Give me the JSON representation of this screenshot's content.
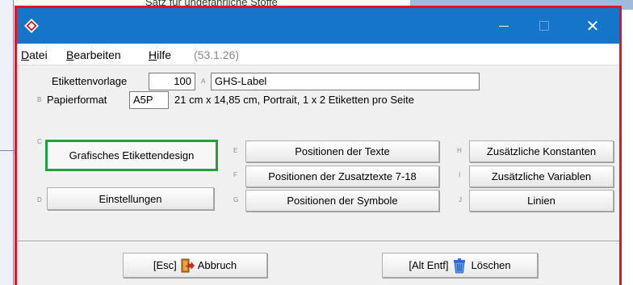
{
  "background": {
    "text": "Satz für ungefährliche Stoffe"
  },
  "window": {
    "accent_color": "#1475c9",
    "focus_color": "#e81123",
    "close_glyph": "✕"
  },
  "menu": {
    "items": [
      {
        "label_ul": "D",
        "label_rest": "atei"
      },
      {
        "label_ul": "B",
        "label_rest": "earbeiten"
      },
      {
        "label_ul": "H",
        "label_rest": "ilfe"
      }
    ],
    "version": "(53.1.26)"
  },
  "form": {
    "etikettenvorlage_label": "Etikettenvorlage",
    "etikettenvorlage_value": "100",
    "key_a": "A",
    "name_value": "GHS-Label",
    "key_b": "B",
    "papierformat_label": "Papierformat",
    "papierformat_value": "A5P",
    "papierformat_desc": "21 cm x 14,85 cm, Portrait, 1 x 2 Etiketten pro Seite"
  },
  "buttons": {
    "key_c": "C",
    "grafisches": "Grafisches Etikettendesign",
    "key_d": "D",
    "einstellungen": "Einstellungen",
    "key_e": "E",
    "positionen_texte": "Positionen der Texte",
    "key_f": "F",
    "positionen_zusatz": "Positionen der Zusatztexte 7-18",
    "key_g": "G",
    "positionen_symbole": "Positionen der Symbole",
    "key_h": "H",
    "konstanten": "Zusätzliche Konstanten",
    "key_i": "I",
    "variablen": "Zusätzliche Variablen",
    "key_j": "J",
    "linien": "Linien"
  },
  "footer": {
    "abbruch_shortcut": "[Esc]",
    "abbruch_label": "Abbruch",
    "abbruch_icon": "exit-door-icon",
    "loeschen_shortcut": "[Alt Entf]",
    "loeschen_label": "Löschen",
    "loeschen_icon": "trash-can-icon"
  }
}
